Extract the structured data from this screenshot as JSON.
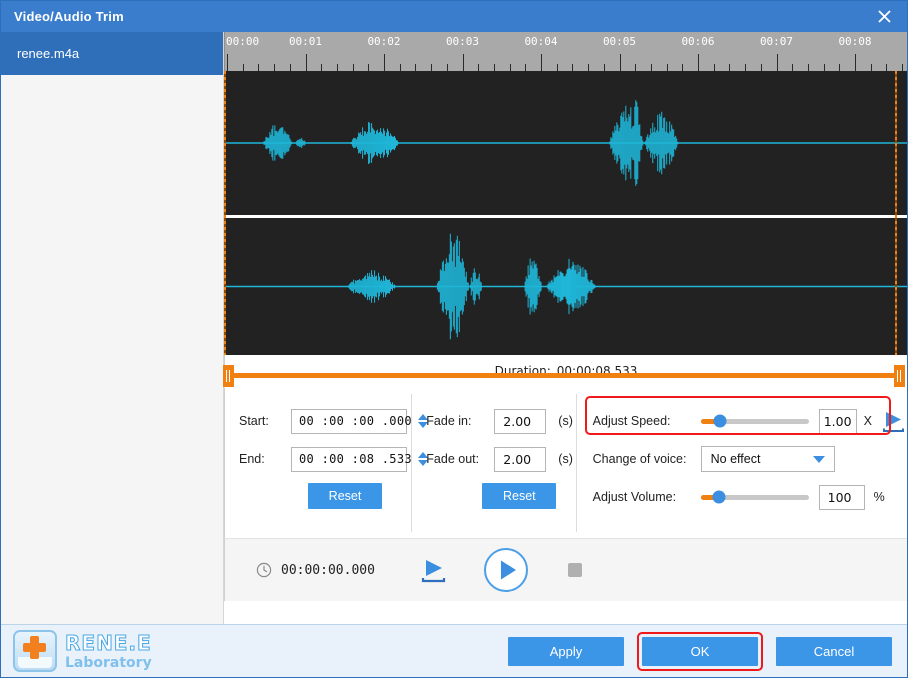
{
  "window": {
    "title": "Video/Audio Trim",
    "close_icon": "close-icon"
  },
  "sidebar": {
    "files": [
      {
        "name": "renee.m4a",
        "selected": true
      }
    ]
  },
  "timeline": {
    "ruler_labels": [
      "00:00",
      "00:01",
      "00:02",
      "00:03",
      "00:04",
      "00:05",
      "00:06",
      "00:07",
      "00:08"
    ],
    "seconds_span": 8.533,
    "minor_ticks_per_second": 5,
    "duration_label": "Duration:",
    "duration_value": "00:00:08.533",
    "waveform_color": "#1fb6d8",
    "waveform_bg": "#222222",
    "trim_color": "#f08010"
  },
  "controls": {
    "start": {
      "label": "Start:",
      "value": "00 :00 :00 .000"
    },
    "end": {
      "label": "End:",
      "value": "00 :00 :08 .533"
    },
    "reset_time_label": "Reset",
    "fade_in": {
      "label": "Fade in:",
      "value": "2.00",
      "unit": "(s)"
    },
    "fade_out": {
      "label": "Fade out:",
      "value": "2.00",
      "unit": "(s)"
    },
    "reset_fade_label": "Reset",
    "adjust_speed": {
      "label": "Adjust Speed:",
      "value": "1.00",
      "unit": "X",
      "slider_percent": 18
    },
    "change_of_voice": {
      "label": "Change of voice:",
      "value": "No effect"
    },
    "adjust_volume": {
      "label": "Adjust Volume:",
      "value": "100",
      "unit": "%",
      "slider_percent": 17
    },
    "highlight_color": "#f01a1a"
  },
  "transport": {
    "clock_icon": "clock-icon",
    "current_time": "00:00:00.000",
    "preview_icon": "preview-play-icon",
    "play_icon": "play-icon",
    "stop_icon": "stop-icon"
  },
  "branding": {
    "name_top": "RENE.E",
    "name_sub": "Laboratory"
  },
  "footer": {
    "apply_label": "Apply",
    "ok_label": "OK",
    "cancel_label": "Cancel"
  }
}
